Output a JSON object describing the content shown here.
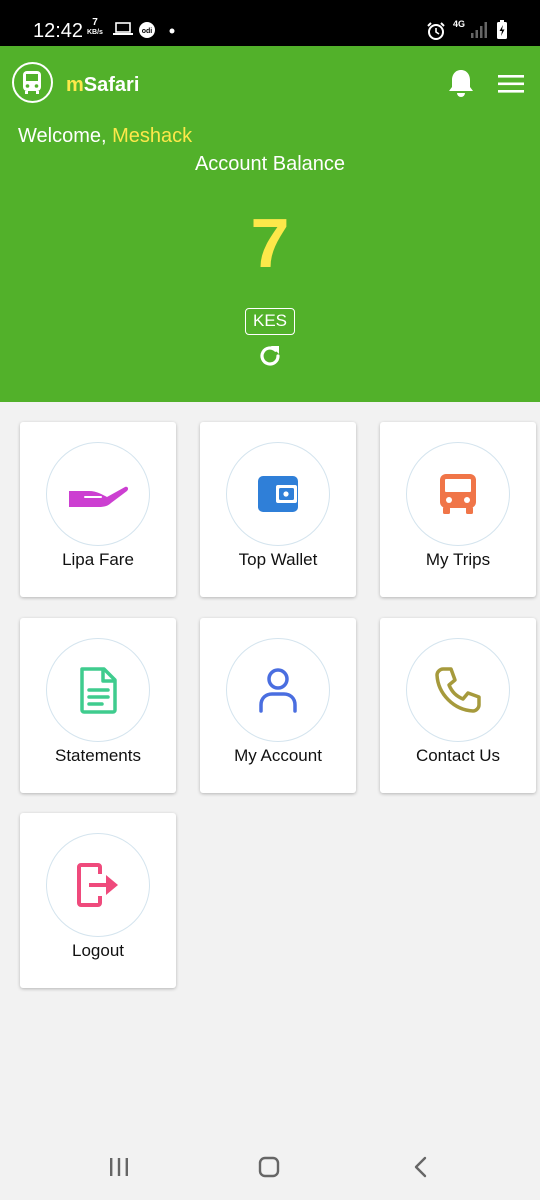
{
  "status_bar": {
    "time": "12:42",
    "speed_value": "7",
    "speed_unit": "KB/s",
    "network": "4G"
  },
  "header": {
    "app_name_prefix": "m",
    "app_name_rest": "Safari",
    "welcome_prefix": "Welcome, ",
    "user_name": "Meshack",
    "balance_label": "Account Balance",
    "balance_value": "7",
    "currency": "KES"
  },
  "tiles": [
    {
      "label": "Lipa Fare",
      "icon": "hand-coin-icon",
      "color": "#cc3fd1"
    },
    {
      "label": "Top Wallet",
      "icon": "wallet-icon",
      "color": "#2f7fd8"
    },
    {
      "label": "My Trips",
      "icon": "bus-icon",
      "color": "#f07548"
    },
    {
      "label": "Statements",
      "icon": "document-icon",
      "color": "#3fcc8e"
    },
    {
      "label": "My Account",
      "icon": "user-icon",
      "color": "#4a6ee0"
    },
    {
      "label": "Contact Us",
      "icon": "phone-icon",
      "color": "#a69a3c"
    },
    {
      "label": "Logout",
      "icon": "logout-icon",
      "color": "#ef4a7c"
    }
  ],
  "colors": {
    "header_bg": "#52b12a",
    "accent_yellow": "#fde84a",
    "page_bg": "#f2f2f2"
  }
}
